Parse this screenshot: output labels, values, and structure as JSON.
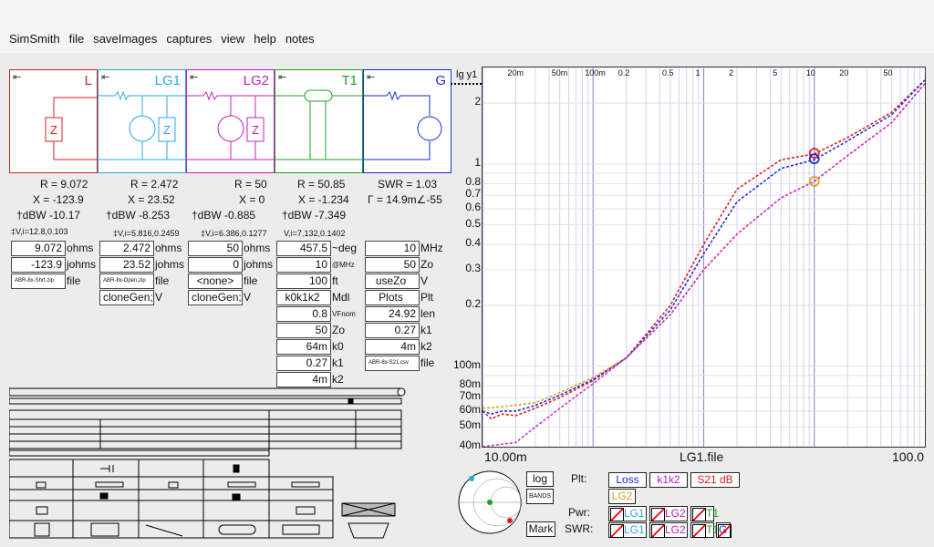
{
  "menu": [
    "SimSmith",
    "file",
    "saveImages",
    "captures",
    "view",
    "help",
    "notes"
  ],
  "blocks": [
    {
      "name": "L",
      "color": "#d42020",
      "R": "R = 9.072",
      "X": "X = -123.9",
      "dBW": "†dBW -10.17",
      "VI": "‡V,i=12.8,0.103",
      "f1": "9.072",
      "u1": "ohms",
      "f2": "-123.9",
      "u2": "johms",
      "file": "ABR-8x-Shrt.zip",
      "fileLbl": "file"
    },
    {
      "name": "LG1",
      "color": "#2aa8e0",
      "R": "R = 2.472",
      "X": "X = 23.52",
      "dBW": "†dBW -8.253",
      "VI": "‡V,i=5.816,0.2459",
      "f1": "2.472",
      "u1": "ohms",
      "f2": "23.52",
      "u2": "johms",
      "file": "ABR-8x-Open.zip",
      "fileLbl": "file",
      "clone": "cloneGen;",
      "cloneU": "V"
    },
    {
      "name": "LG2",
      "color": "#c020c0",
      "R": "R = 50",
      "X": "X = 0",
      "dBW": "†dBW -0.885",
      "VI": "‡V,i=6.386,0.1277",
      "f1": "50",
      "u1": "ohms",
      "f2": "0",
      "u2": "johms",
      "file": "<none>",
      "fileLbl": "file",
      "clone": "cloneGen;",
      "cloneU": "V"
    },
    {
      "name": "T1",
      "color": "#20a020",
      "R": "R = 50.85",
      "X": "X = -1.234",
      "dBW": "†dBW -7.349",
      "VI": "V,i=7.132,0.1402",
      "rows": [
        [
          "457.5",
          "~deg"
        ],
        [
          "10",
          "@MHz"
        ],
        [
          "100",
          "ft"
        ],
        [
          "k0k1k2",
          "Mdl"
        ],
        [
          "0.8",
          "VFnom"
        ],
        [
          "50",
          "Zo"
        ],
        [
          "64m",
          "k0"
        ],
        [
          "0.27",
          "k1"
        ],
        [
          "4m",
          "k2"
        ]
      ]
    },
    {
      "name": "G",
      "color": "#1a2ad0",
      "R": "SWR = 1.03",
      "X": "Γ = 14.9m∠-55",
      "rows": [
        [
          "10",
          "MHz"
        ],
        [
          "50",
          "Zo"
        ],
        [
          "useZo",
          "V"
        ],
        [
          "Plots",
          "Plt"
        ],
        [
          "24.92",
          "len"
        ],
        [
          "0.27",
          "k1"
        ],
        [
          "4m",
          "k2"
        ],
        [
          "ABR-8x-S21.csv",
          "file"
        ]
      ]
    }
  ],
  "chart_data": {
    "type": "line",
    "title": "",
    "ylabel": "lg y1",
    "xlabel": "LG1.file",
    "x_left_label": "10.00m",
    "x_right_label": "100.0",
    "x_top_ticks": [
      "20m",
      "50m",
      "100m",
      "0.2",
      "0.5",
      "1",
      "2",
      "5",
      "10",
      "20",
      "50"
    ],
    "y_ticks": [
      "2",
      "1",
      "0.8",
      "0.7",
      "0.6",
      "0.5",
      "0.4",
      "0.3",
      "0.2",
      "100m",
      "80m",
      "70m",
      "60m",
      "50m",
      "40m"
    ],
    "xlim": [
      0.01,
      100
    ],
    "ylim": [
      0.04,
      3
    ],
    "series": [
      {
        "color": "#e02020",
        "x": [
          0.01,
          0.012,
          0.015,
          0.02,
          0.03,
          0.05,
          0.1,
          0.2,
          0.5,
          1,
          2,
          5,
          10,
          20,
          50,
          100
        ],
        "y": [
          0.06,
          0.055,
          0.058,
          0.057,
          0.062,
          0.07,
          0.085,
          0.11,
          0.2,
          0.4,
          0.75,
          1.05,
          1.12,
          1.35,
          1.8,
          2.6
        ]
      },
      {
        "color": "#2030d0",
        "x": [
          0.01,
          0.012,
          0.015,
          0.02,
          0.03,
          0.05,
          0.1,
          0.2,
          0.5,
          1,
          2,
          5,
          10,
          20,
          50,
          100
        ],
        "y": [
          0.06,
          0.058,
          0.06,
          0.06,
          0.064,
          0.072,
          0.086,
          0.11,
          0.19,
          0.36,
          0.65,
          0.95,
          1.05,
          1.3,
          1.75,
          2.6
        ]
      },
      {
        "color": "#e0a020",
        "x": [
          0.01,
          0.015,
          0.03,
          0.05,
          0.1,
          0.2,
          0.5,
          1,
          2,
          5,
          10,
          20,
          50,
          100
        ],
        "y": [
          0.062,
          0.063,
          0.066,
          0.074,
          0.088,
          0.11,
          0.18,
          0.3,
          0.45,
          0.68,
          0.82,
          1.1,
          1.6,
          2.5
        ]
      },
      {
        "color": "#d030d0",
        "x": [
          0.01,
          0.02,
          0.03,
          0.05,
          0.1,
          0.2,
          0.5,
          1,
          2,
          5,
          10,
          20,
          50,
          100
        ],
        "y": [
          0.04,
          0.042,
          0.05,
          0.062,
          0.082,
          0.11,
          0.18,
          0.3,
          0.45,
          0.68,
          0.82,
          1.1,
          1.6,
          2.5
        ]
      }
    ],
    "markers": [
      {
        "x": 10,
        "y": 1.13,
        "color": "#e02020"
      },
      {
        "x": 10,
        "y": 1.06,
        "color": "#2030d0"
      },
      {
        "x": 10,
        "y": 0.82,
        "color": "#e0a020"
      }
    ]
  },
  "controls": {
    "log": "log",
    "bands": "BANDS",
    "mark": "Mark",
    "plt": "Plt:",
    "pwr": "Pwr:",
    "swr": "SWR:",
    "plt_items": [
      "Loss",
      "k1k2",
      "S21 dB",
      "LG2"
    ],
    "pwr_items": [
      "LG1",
      "LG2",
      "T1"
    ],
    "swr_items": [
      "LG1",
      "LG2",
      "T1",
      "G"
    ]
  },
  "colors": {
    "L": "#d42020",
    "LG1": "#2aa8e0",
    "LG2": "#c020c0",
    "T1": "#20a020",
    "G": "#1a2ad0"
  }
}
